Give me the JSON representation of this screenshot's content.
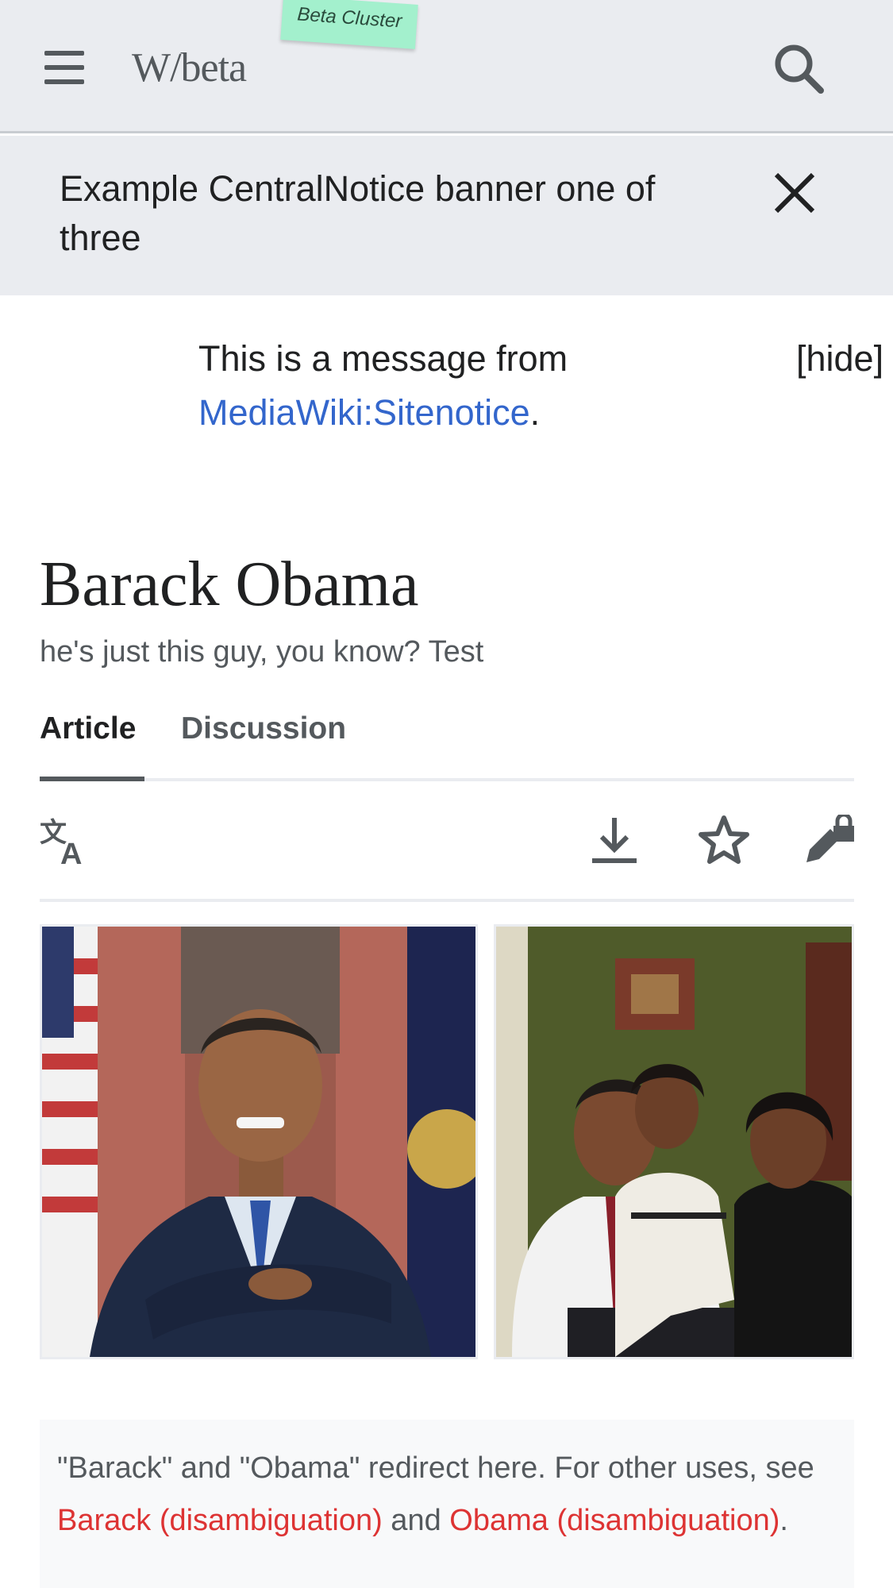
{
  "header": {
    "wordmark": "W/beta",
    "beta_tag": "Beta Cluster",
    "menu_icon": "hamburger-menu-icon",
    "search_icon": "search-icon"
  },
  "banner": {
    "text": "Example CentralNotice banner one of three",
    "close_icon": "close-icon"
  },
  "sitenotice": {
    "text": "This is a message from",
    "link": "MediaWiki:Sitenotice",
    "suffix": ".",
    "hide": "[hide]"
  },
  "article": {
    "title": "Barack Obama",
    "tagline": "he's just this guy, you know? Test"
  },
  "tabs": [
    {
      "label": "Article",
      "active": true
    },
    {
      "label": "Discussion",
      "active": false
    }
  ],
  "actions": {
    "language_icon": "language-icon",
    "download_icon": "download-icon",
    "watch_icon": "star-icon",
    "edit_icon": "edit-lock-icon"
  },
  "gallery": {
    "images": [
      "portrait-photo",
      "family-photo"
    ]
  },
  "hatnote": {
    "text1": "\"Barack\" and \"Obama\" redirect here. For other uses, see ",
    "link1": "Barack (disambiguation)",
    "text2": " and ",
    "link2": "Obama (disambiguation)",
    "text3": "."
  },
  "colors": {
    "header_bg": "#eaecf0",
    "link_blue": "#3366cc",
    "redlink": "#dd3333",
    "text": "#202122",
    "muted": "#54595d"
  }
}
